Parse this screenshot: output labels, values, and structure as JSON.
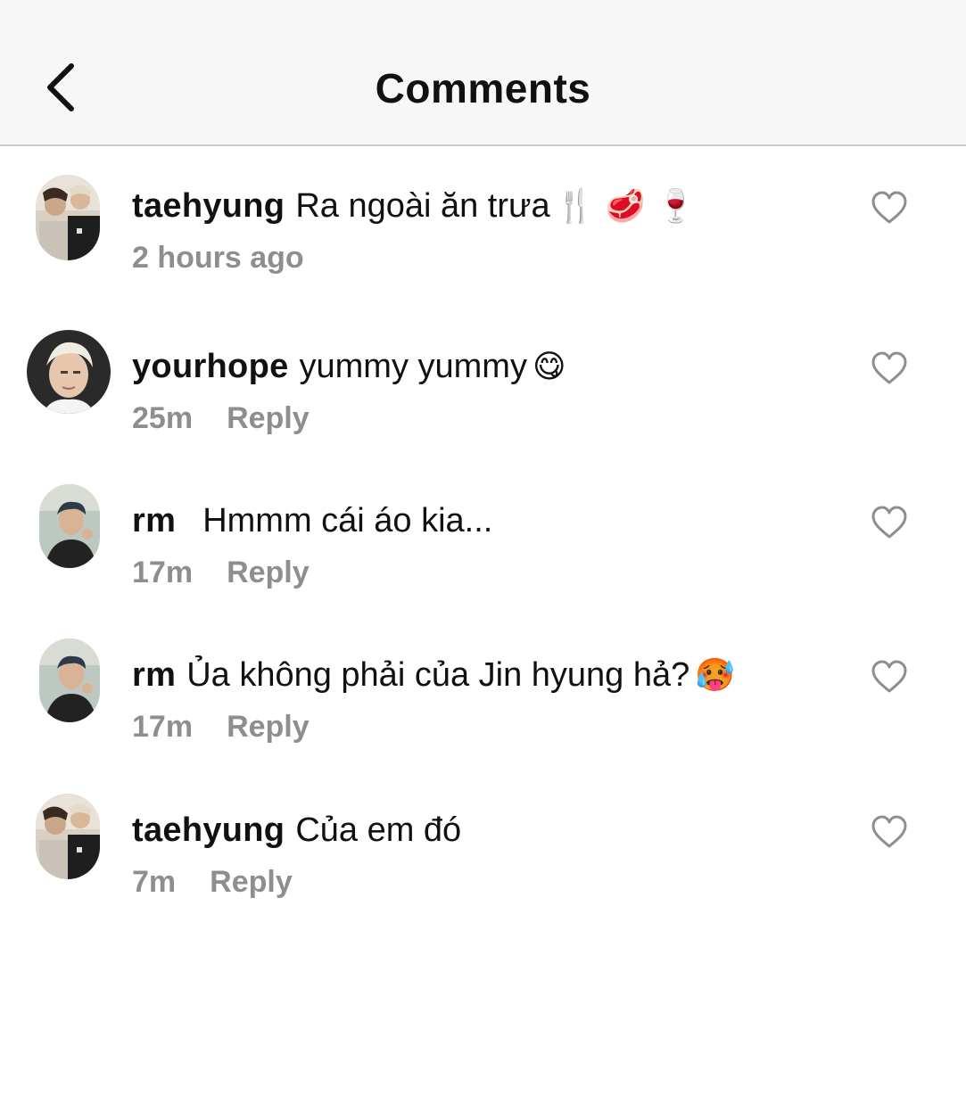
{
  "header": {
    "title": "Comments",
    "back_icon": "chevron-left-icon"
  },
  "comments": [
    {
      "username": "taehyung",
      "text": "Ra ngoài ăn trưa",
      "emojis": "🍴 🥩 🍷",
      "time": "2 hours ago",
      "reply_label": ""
    },
    {
      "username": "yourhope",
      "text": "yummy yummy",
      "emojis": "😋",
      "time": "25m",
      "reply_label": "Reply"
    },
    {
      "username": "rm",
      "text": "Hmmm cái áo kia...",
      "emojis": "",
      "time": "17m",
      "reply_label": "Reply"
    },
    {
      "username": "rm",
      "text": "Ủa không phải của Jin hyung hả?",
      "emojis": "🥵",
      "time": "17m",
      "reply_label": "Reply"
    },
    {
      "username": "taehyung",
      "text": "Của em đó",
      "emojis": "",
      "time": "7m",
      "reply_label": "Reply"
    }
  ],
  "colors": {
    "header_bg": "#f7f7f7",
    "text": "#111111",
    "meta": "#8e8e8e",
    "heart_stroke": "#8e8e8e"
  }
}
